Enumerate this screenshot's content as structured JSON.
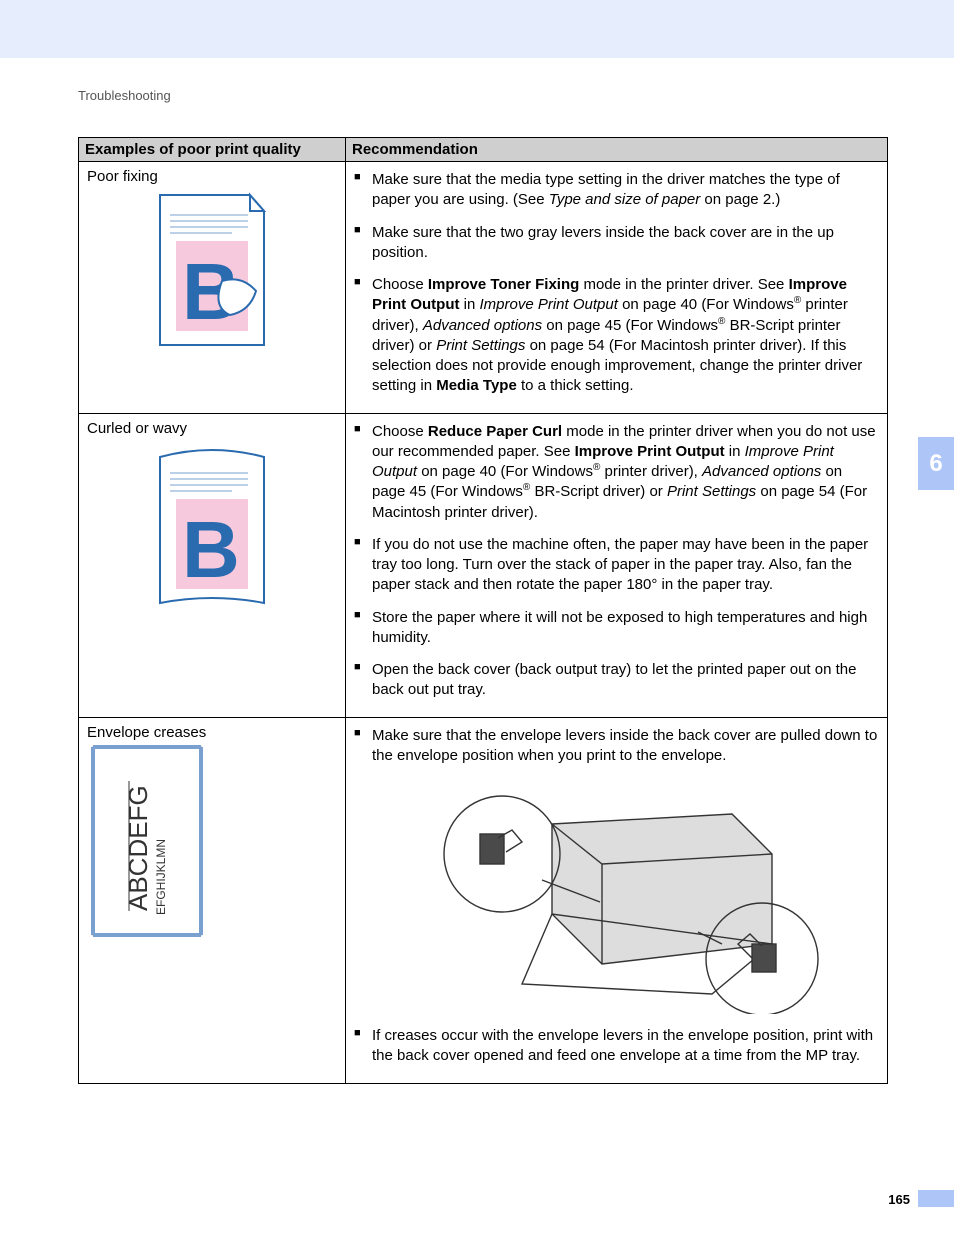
{
  "header": {
    "breadcrumb": "Troubleshooting"
  },
  "side": {
    "chapter": "6"
  },
  "footer": {
    "page": "165"
  },
  "table": {
    "headers": {
      "col1": "Examples of poor print quality",
      "col2": "Recommendation"
    }
  },
  "rows": {
    "r1": {
      "label": "Poor fixing",
      "items": {
        "a1a": "Make sure that the media type setting in the driver matches the type of paper you are using. (See ",
        "a1b": "Type and size of paper",
        "a1c": " on page 2.)",
        "a2": "Make sure that the two gray levers inside the back cover are in the up position.",
        "a3a": "Choose ",
        "a3b": "Improve Toner Fixing",
        "a3c": " mode in the printer driver. See ",
        "a3d": "Improve Print Output",
        "a3e": " in ",
        "a3f": "Improve Print Output",
        "a3g": " on page 40 (For Windows",
        "a3h": " printer driver), ",
        "a3i": "Advanced options",
        "a3j": " on page 45 (For Windows",
        "a3k": " BR-Script printer driver) or ",
        "a3l": "Print Settings",
        "a3m": " on page 54 (For Macintosh printer driver). If this selection does not provide enough improvement, change the printer driver setting in ",
        "a3n": "Media Type",
        "a3o": " to a thick setting."
      }
    },
    "r2": {
      "label": "Curled or wavy",
      "items": {
        "b1a": "Choose ",
        "b1b": "Reduce Paper Curl",
        "b1c": " mode in the printer driver when you do not use our recommended paper. See ",
        "b1d": "Improve Print Output",
        "b1e": " in ",
        "b1f": "Improve Print Output",
        "b1g": " on page 40 (For Windows",
        "b1h": " printer driver), ",
        "b1i": "Advanced options",
        "b1j": " on page 45 (For Windows",
        "b1k": " BR-Script driver) or ",
        "b1l": "Print Settings",
        "b1m": " on page 54 (For Macintosh printer driver).",
        "b2": "If you do not use the machine often, the paper may have been in the paper tray too long. Turn over the stack of paper in the paper tray. Also, fan the paper stack and then rotate the paper 180° in the paper tray.",
        "b3": "Store the paper where it will not be exposed to high temperatures and high humidity.",
        "b4": "Open the back cover (back output tray) to let the printed paper out on the back out put tray."
      }
    },
    "r3": {
      "label": "Envelope creases",
      "env_text": {
        "big": "ABCDEFG",
        "small": "EFGHIJKLMN"
      },
      "items": {
        "c1": "Make sure that the envelope levers inside the back cover are pulled down to the envelope position when you print to the envelope.",
        "c2": "If creases occur with the envelope levers in the envelope position, print with the back cover opened and feed one envelope at a time from the MP tray."
      }
    }
  },
  "reg": "®"
}
